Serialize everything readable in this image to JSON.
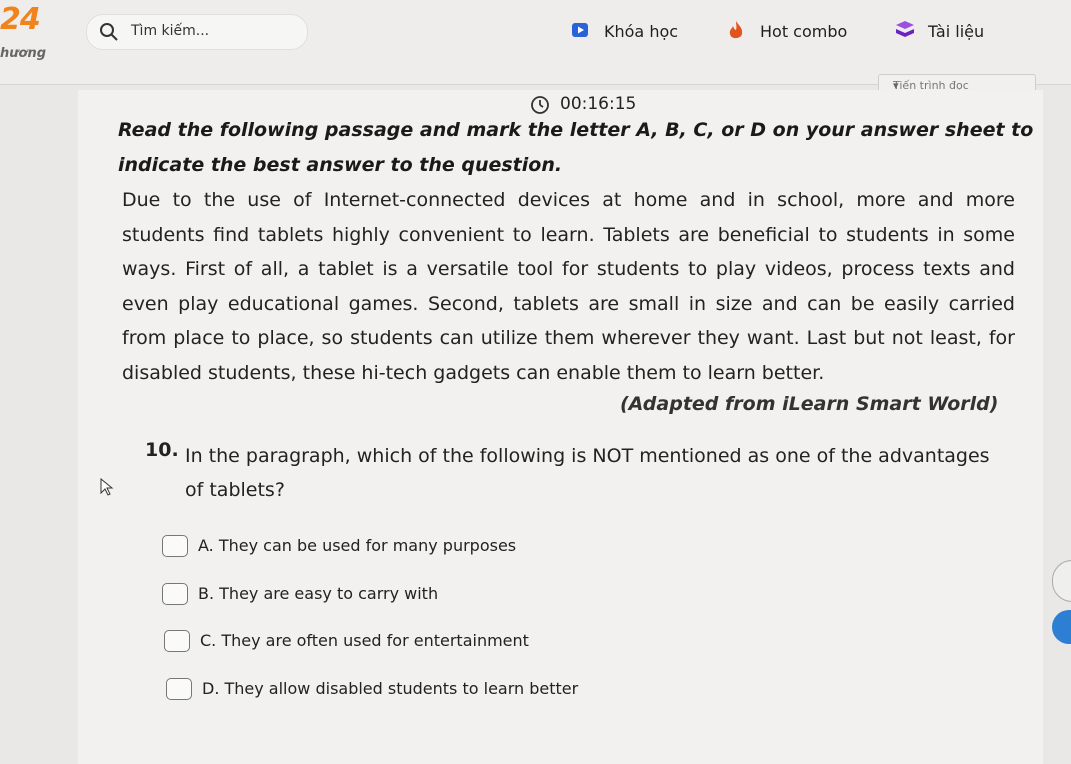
{
  "header": {
    "logo": "24",
    "brand_sub": "hương",
    "search_placeholder": "Tìm kiếm...",
    "nav": [
      {
        "label": "Khóa học",
        "icon": "play-icon",
        "color": "#2a63d6"
      },
      {
        "label": "Hot combo",
        "icon": "fire-icon",
        "color": "#e2541b"
      },
      {
        "label": "Tài liệu",
        "icon": "book-icon",
        "color": "#7b2fcf"
      }
    ],
    "subnav_label": "Tiến trình đọc"
  },
  "timer": {
    "value": "00:16:15",
    "icon": "clock-icon"
  },
  "instruction": "Read the following passage and mark the letter A, B, C, or D on your answer sheet to indicate the best answer to the question.",
  "passage": "Due to the use of Internet-connected devices at home and in school, more and more students find tablets highly convenient to learn. Tablets are beneficial to students in some ways. First of all, a tablet is a versatile tool for students to play videos, process texts and even play educational games. Second, tablets are small in size and can be easily carried from place to place, so students can utilize them wherever they want. Last but not least, for disabled students, these hi-tech gadgets can enable them to learn better.",
  "source": "(Adapted from iLearn Smart World)",
  "question": {
    "number": "10.",
    "text": "In the paragraph, which of the following is NOT mentioned as one of the advantages of tablets?",
    "options": [
      "A. They can be used for many purposes",
      "B. They are easy to carry with",
      "C. They are often used for entertainment",
      "D. They allow disabled students to learn better"
    ]
  }
}
